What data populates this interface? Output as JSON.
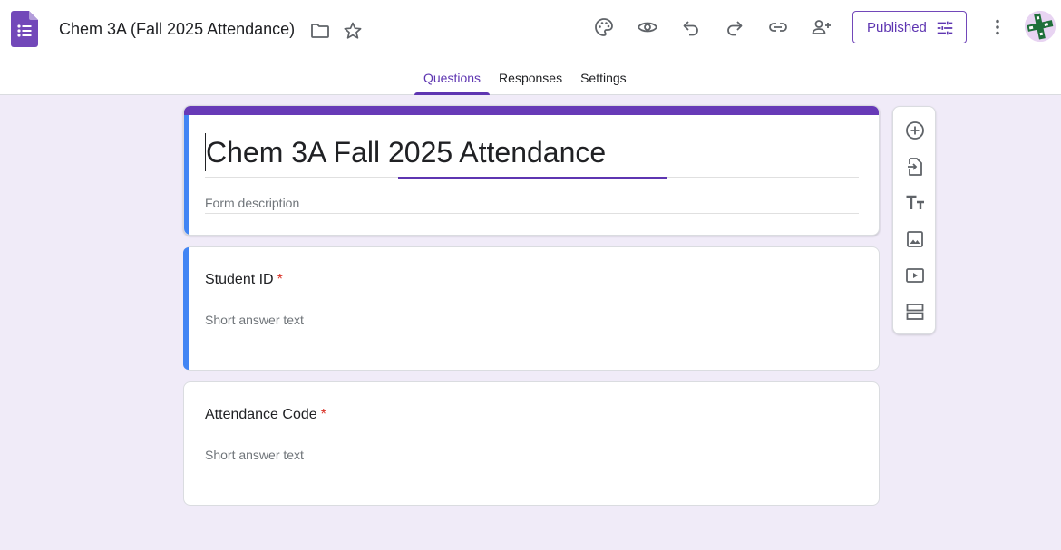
{
  "header": {
    "app_icon": "forms-logo-icon",
    "doc_title": "Chem 3A (Fall 2025 Attendance)",
    "publish_label": "Published",
    "icons": [
      "folder-icon",
      "star-icon",
      "palette-icon",
      "preview-eye-icon",
      "undo-icon",
      "redo-icon",
      "link-icon",
      "add-collaborator-icon",
      "publish-settings-icon",
      "more-vert-icon",
      "avatar"
    ]
  },
  "tabs": [
    {
      "label": "Questions",
      "active": true
    },
    {
      "label": "Responses",
      "active": false
    },
    {
      "label": "Settings",
      "active": false
    }
  ],
  "form": {
    "title": "Chem 3A Fall 2025 Attendance",
    "description_placeholder": "Form description"
  },
  "questions": [
    {
      "title": "Student ID",
      "required_mark": "*",
      "answer_placeholder": "Short answer text"
    },
    {
      "title": "Attendance Code",
      "required_mark": "*",
      "answer_placeholder": "Short answer text"
    }
  ],
  "side_toolbar": [
    "add-question-icon",
    "import-questions-icon",
    "add-title-icon",
    "add-image-icon",
    "add-video-icon",
    "add-section-icon"
  ],
  "colors": {
    "background": "#f0ebf8",
    "accent": "#673ab7",
    "active_question": "#4285f4",
    "required": "#d93025"
  }
}
